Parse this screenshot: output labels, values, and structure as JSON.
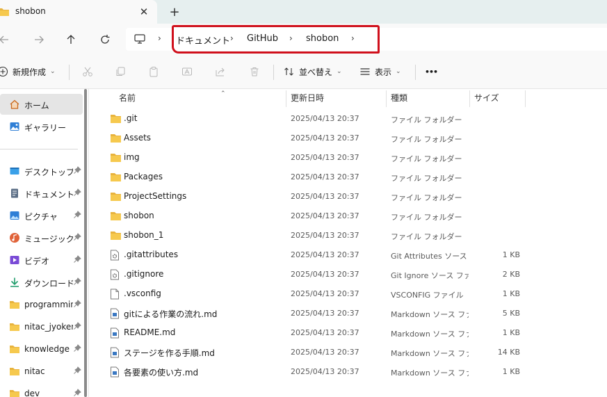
{
  "tab": {
    "title": "shobon",
    "close": "✕",
    "new_tab": "+"
  },
  "address": {
    "separator": "›",
    "crumbs": [
      "ドキュメント",
      "GitHub",
      "shobon"
    ]
  },
  "commands": {
    "new_label": "新規作成",
    "sort_label": "並べ替え",
    "view_label": "表示",
    "more": "•••"
  },
  "sidebar": {
    "items": [
      {
        "label": "ホーム",
        "icon": "home-icon"
      },
      {
        "label": "ギャラリー",
        "icon": "gallery-icon"
      },
      {
        "label": "デスクトップ",
        "icon": "desktop-icon"
      },
      {
        "label": "ドキュメント",
        "icon": "documents-icon"
      },
      {
        "label": "ピクチャ",
        "icon": "pictures-icon"
      },
      {
        "label": "ミュージック",
        "icon": "music-icon"
      },
      {
        "label": "ビデオ",
        "icon": "video-icon"
      },
      {
        "label": "ダウンロード",
        "icon": "download-icon"
      },
      {
        "label": "programming",
        "icon": "folder-icon"
      },
      {
        "label": "nitac_jyoken_",
        "icon": "folder-icon"
      },
      {
        "label": "knowledge",
        "icon": "folder-icon"
      },
      {
        "label": "nitac",
        "icon": "folder-icon"
      },
      {
        "label": "dev",
        "icon": "folder-icon"
      }
    ]
  },
  "columns": {
    "name": "名前",
    "date": "更新日時",
    "type": "種類",
    "size": "サイズ"
  },
  "files": [
    {
      "name": ".git",
      "date": "2025/04/13 20:37",
      "type": "ファイル フォルダー",
      "size": "",
      "kind": "folder"
    },
    {
      "name": "Assets",
      "date": "2025/04/13 20:37",
      "type": "ファイル フォルダー",
      "size": "",
      "kind": "folder"
    },
    {
      "name": "img",
      "date": "2025/04/13 20:37",
      "type": "ファイル フォルダー",
      "size": "",
      "kind": "folder"
    },
    {
      "name": "Packages",
      "date": "2025/04/13 20:37",
      "type": "ファイル フォルダー",
      "size": "",
      "kind": "folder"
    },
    {
      "name": "ProjectSettings",
      "date": "2025/04/13 20:37",
      "type": "ファイル フォルダー",
      "size": "",
      "kind": "folder"
    },
    {
      "name": "shobon",
      "date": "2025/04/13 20:37",
      "type": "ファイル フォルダー",
      "size": "",
      "kind": "folder"
    },
    {
      "name": "shobon_1",
      "date": "2025/04/13 20:37",
      "type": "ファイル フォルダー",
      "size": "",
      "kind": "folder"
    },
    {
      "name": ".gitattributes",
      "date": "2025/04/13 20:37",
      "type": "Git Attributes ソース ファイル",
      "size": "1 KB",
      "kind": "gear"
    },
    {
      "name": ".gitignore",
      "date": "2025/04/13 20:37",
      "type": "Git Ignore ソース ファイル",
      "size": "2 KB",
      "kind": "gear"
    },
    {
      "name": ".vsconfig",
      "date": "2025/04/13 20:37",
      "type": "VSCONFIG ファイル",
      "size": "1 KB",
      "kind": "file"
    },
    {
      "name": "gitによる作業の流れ.md",
      "date": "2025/04/13 20:37",
      "type": "Markdown ソース ファイル",
      "size": "5 KB",
      "kind": "md"
    },
    {
      "name": "README.md",
      "date": "2025/04/13 20:37",
      "type": "Markdown ソース ファイル",
      "size": "1 KB",
      "kind": "md"
    },
    {
      "name": "ステージを作る手順.md",
      "date": "2025/04/13 20:37",
      "type": "Markdown ソース ファイル",
      "size": "14 KB",
      "kind": "md"
    },
    {
      "name": "各要素の使い方.md",
      "date": "2025/04/13 20:37",
      "type": "Markdown ソース ファイル",
      "size": "1 KB",
      "kind": "md"
    }
  ]
}
